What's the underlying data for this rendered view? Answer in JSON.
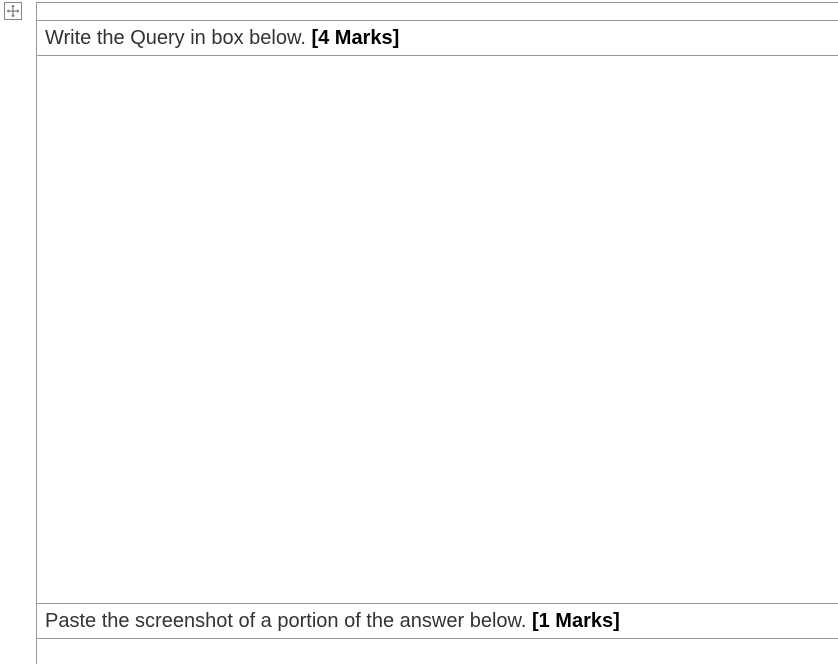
{
  "table": {
    "row1": {
      "text": "Write the Query in box below. ",
      "marks": "[4 Marks]"
    },
    "row2": {
      "text": "Paste the screenshot of a portion of the answer below. ",
      "marks": "[1 Marks]"
    }
  }
}
